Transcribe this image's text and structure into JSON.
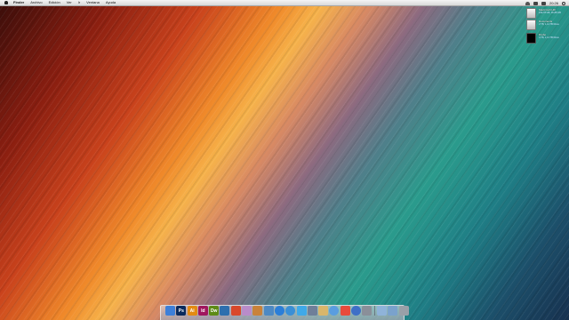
{
  "menubar": {
    "apple_icon": "apple-icon",
    "items": [
      {
        "label": "Finder",
        "bold": true
      },
      {
        "label": "Archivo",
        "bold": false
      },
      {
        "label": "Edición",
        "bold": false
      },
      {
        "label": "Ver",
        "bold": false
      },
      {
        "label": "Ir",
        "bold": false
      },
      {
        "label": "Ventana",
        "bold": false
      },
      {
        "label": "Ayuda",
        "bold": false
      }
    ],
    "right_icons": [
      "wifi-icon",
      "volume-icon",
      "battery-icon",
      "search-icon"
    ],
    "clock": "20:26"
  },
  "desktop_items": [
    {
      "name": "Macintosh HD",
      "info": "249,78 GB, 36,88 GB",
      "icon": "hard-drive-icon"
    },
    {
      "name": "Documents",
      "info": "2 TB, 1,14 TB libres",
      "icon": "external-drive-icon"
    },
    {
      "name": "Drobo",
      "info": "4 TB, 1,14 TB libres",
      "icon": "drobo-drive-icon"
    }
  ],
  "dock": {
    "apps": [
      {
        "name": "finder-icon",
        "label": "",
        "color": "#3d7fd9"
      },
      {
        "name": "photoshop-icon",
        "label": "Ps",
        "color": "#0a2a5c"
      },
      {
        "name": "illustrator-icon",
        "label": "Ai",
        "color": "#e38a12"
      },
      {
        "name": "indesign-icon",
        "label": "Id",
        "color": "#a0165e"
      },
      {
        "name": "dreamweaver-icon",
        "label": "Dw",
        "color": "#5d8a16"
      },
      {
        "name": "pen-tool-icon",
        "label": "",
        "color": "#2d6fae"
      },
      {
        "name": "color-app-icon",
        "label": "",
        "color": "#d9482b"
      },
      {
        "name": "palette-icon",
        "label": "",
        "color": "#b98cc9"
      },
      {
        "name": "mail-stamp-icon",
        "label": "",
        "color": "#c9823a"
      },
      {
        "name": "preview-icon",
        "label": "",
        "color": "#4d89c4"
      },
      {
        "name": "app-store-icon",
        "label": "",
        "color": "#2b7ed8"
      },
      {
        "name": "safari-icon",
        "label": "",
        "color": "#3a8fd6"
      },
      {
        "name": "twitter-icon",
        "label": "",
        "color": "#3fa9e8"
      },
      {
        "name": "reader-icon",
        "label": "",
        "color": "#6f7f99"
      },
      {
        "name": "notes-icon",
        "label": "",
        "color": "#d9b66b"
      },
      {
        "name": "messages-icon",
        "label": "",
        "color": "#5a9de0"
      },
      {
        "name": "calendar-icon",
        "label": "",
        "color": "#e84b3c"
      },
      {
        "name": "itunes-icon",
        "label": "",
        "color": "#3f6fc7"
      },
      {
        "name": "system-preferences-icon",
        "label": "",
        "color": "#8a8f99"
      },
      {
        "name": "applications-folder-icon",
        "label": "",
        "color": "#8fb3d9"
      },
      {
        "name": "downloads-folder-icon",
        "label": "",
        "color": "#7aa2cc"
      },
      {
        "name": "trash-icon",
        "label": "",
        "color": "#9aa0a8"
      }
    ]
  }
}
